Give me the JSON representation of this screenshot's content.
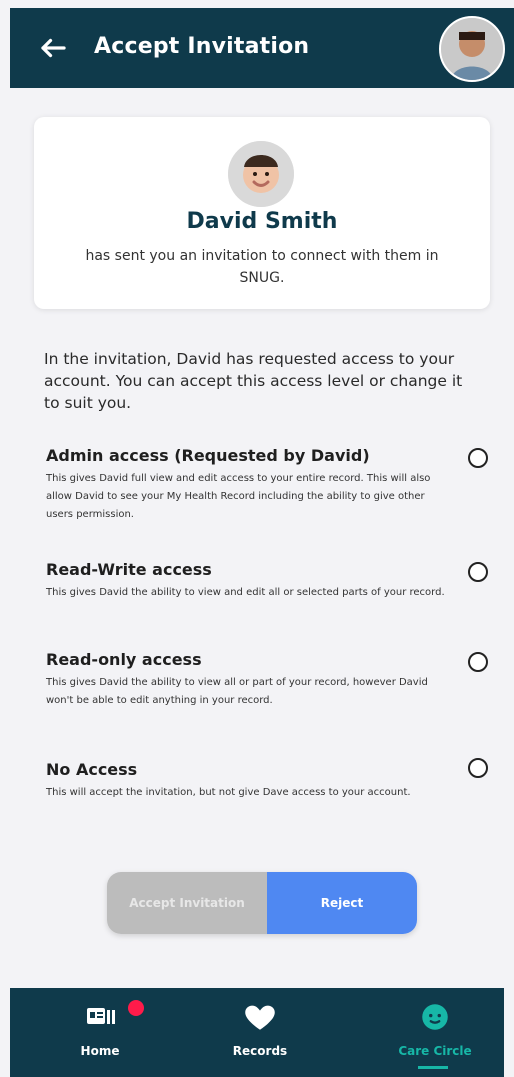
{
  "header": {
    "title": "Accept Invitation",
    "back_icon": "arrow-left-icon",
    "avatar_icon": "user-avatar"
  },
  "sender": {
    "name": "David Smith",
    "message": "has sent you an invitation to connect with them in SNUG.",
    "avatar_icon": "child-avatar"
  },
  "intro": "In the invitation, David has requested access to your account. You can accept this access level or change it to suit you.",
  "options": [
    {
      "title": "Admin access (Requested by David)",
      "description": "This gives David full view and edit access to your entire record. This will also allow David to see your My Health Record including the ability to give other users permission.",
      "selected": false
    },
    {
      "title": "Read-Write access",
      "description": "This gives David the ability to view and edit all or selected parts of your record.",
      "selected": false
    },
    {
      "title": "Read-only access",
      "description": "This gives David the ability to view all or part of your record, however David won't be able to edit anything in your record.",
      "selected": false
    },
    {
      "title": "No Access",
      "description": "This will accept the invitation, but not give Dave access to your account.",
      "selected": false
    }
  ],
  "buttons": {
    "accept_label": "Accept Invitation",
    "reject_label": "Reject"
  },
  "nav": {
    "home_label": "Home",
    "records_label": "Records",
    "care_label": "Care Circle",
    "active": "Care Circle"
  },
  "colors": {
    "header_bg": "#0f3a4b",
    "accent_teal": "#17b7a7",
    "reject_blue": "#4f88f2",
    "disabled_gray": "#bcbcbc",
    "badge_red": "#ff1b4a"
  }
}
